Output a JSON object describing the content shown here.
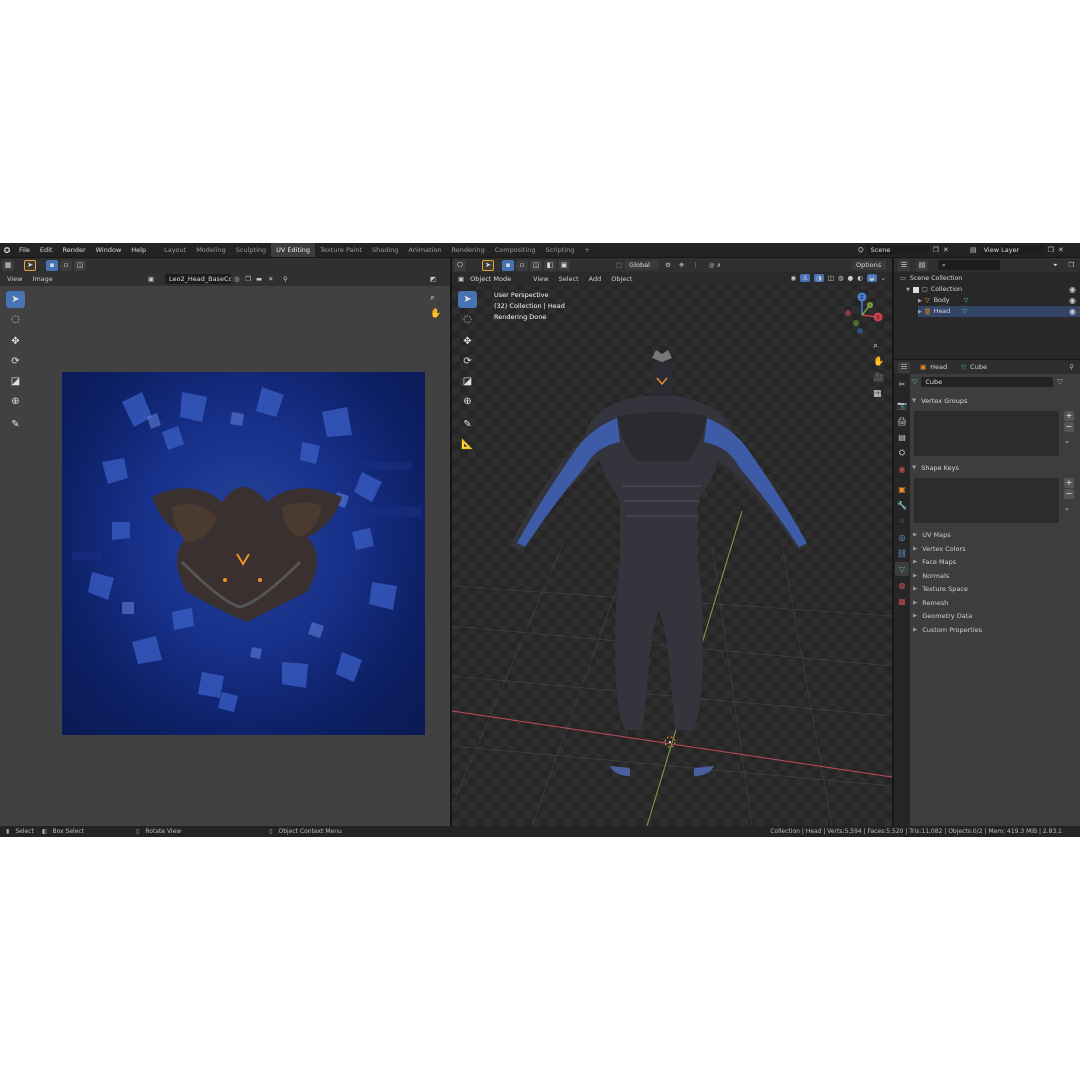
{
  "topbar": {
    "menus": [
      "File",
      "Edit",
      "Render",
      "Window",
      "Help"
    ],
    "workspaces": [
      "Layout",
      "Modeling",
      "Sculpting",
      "UV Editing",
      "Texture Paint",
      "Shading",
      "Animation",
      "Rendering",
      "Compositing",
      "Scripting"
    ],
    "active_workspace": "UV Editing",
    "add_tab": "+",
    "scene_label": "Scene",
    "view_layer_label": "View Layer"
  },
  "uv_editor": {
    "menus": [
      "View",
      "Image"
    ],
    "image_name": "Leo2_Head_BaseCol...",
    "tools": [
      "cursor-tool-icon",
      "circle-select-icon",
      "move-icon",
      "rotate-icon",
      "scale-icon",
      "transform-icon",
      "annotate-icon"
    ]
  },
  "viewport": {
    "mode": "Object Mode",
    "menus": [
      "View",
      "Select",
      "Add",
      "Object"
    ],
    "transform_orientation": "Global",
    "options_label": "Options",
    "overlay": [
      "User Perspective",
      "(32) Collection | Head",
      "Rendering Done"
    ],
    "gizmo_axes": [
      "X",
      "Y",
      "Z"
    ]
  },
  "outliner": {
    "root": "Scene Collection",
    "collection": "Collection",
    "items": [
      "Body",
      "Head"
    ]
  },
  "properties": {
    "object_name": "Head",
    "mesh_name": "Cube",
    "data_name": "Cube",
    "sections_open": [
      "Vertex Groups",
      "Shape Keys"
    ],
    "sections_closed": [
      "UV Maps",
      "Vertex Colors",
      "Face Maps",
      "Normals",
      "Texture Space",
      "Remesh",
      "Geometry Data",
      "Custom Properties"
    ]
  },
  "status": {
    "select": "Select",
    "box_select": "Box Select",
    "rotate_view": "Rotate View",
    "context_menu": "Object Context Menu",
    "stats": "Collection | Head | Verts:5,594 | Faces:5,520 | Tris:11,082 | Objects:0/2 | Mem: 419.3 MiB | 2.83.1"
  },
  "colors": {
    "accent": "#4772b3",
    "uv_background": "#0c1f63",
    "object_highlight": "#f18f2a"
  }
}
